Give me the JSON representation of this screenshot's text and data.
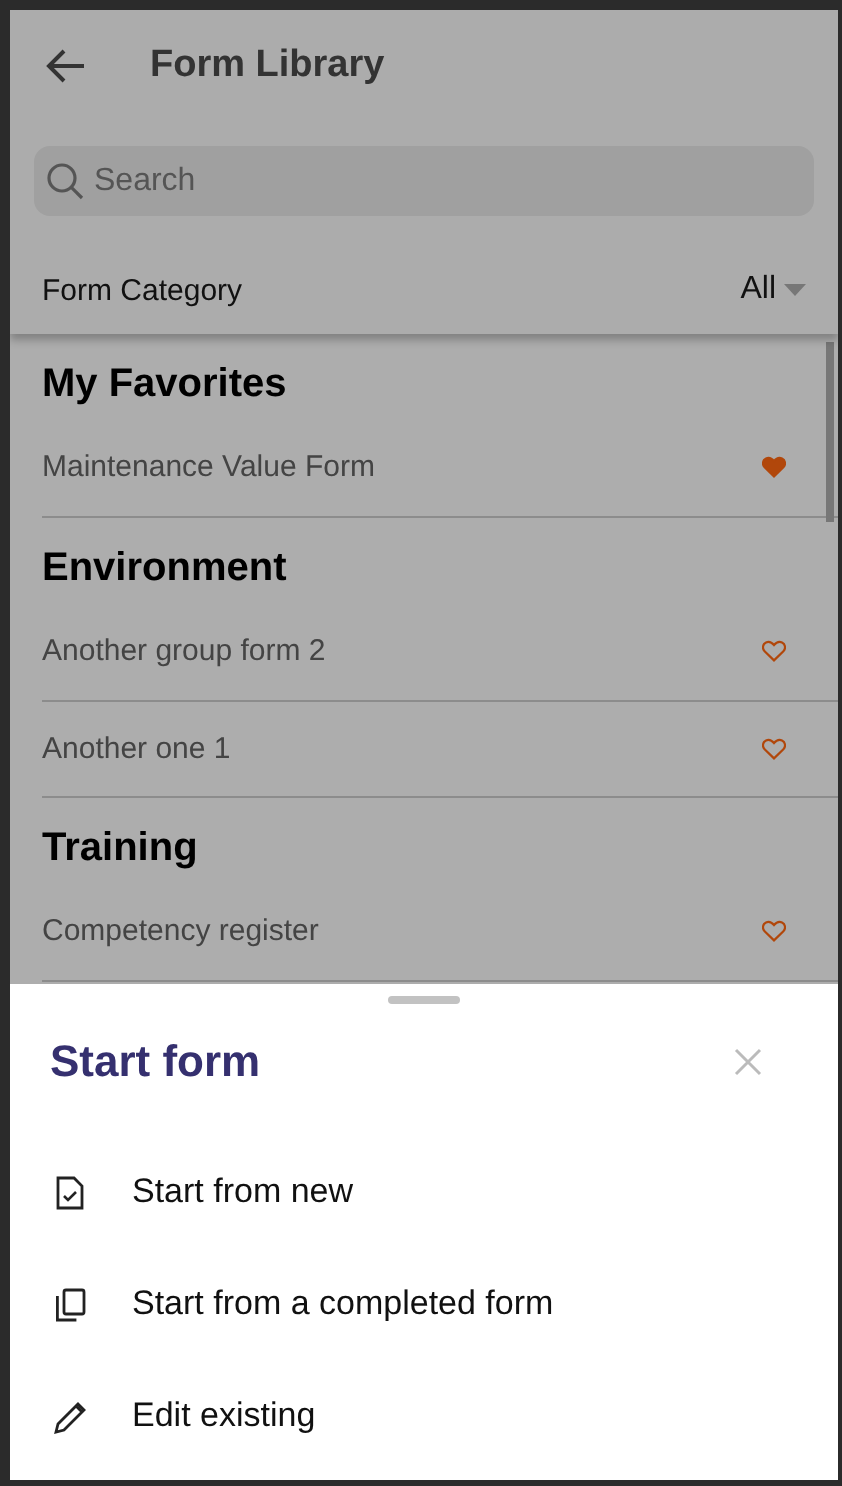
{
  "header": {
    "title": "Form Library"
  },
  "search": {
    "placeholder": "Search"
  },
  "filter": {
    "label": "Form Category",
    "value": "All"
  },
  "sections": [
    {
      "title": "My Favorites",
      "forms": [
        {
          "name": "Maintenance Value Form",
          "favorite": true
        }
      ]
    },
    {
      "title": "Environment",
      "forms": [
        {
          "name": "Another group form 2",
          "favorite": false
        },
        {
          "name": "Another one 1",
          "favorite": false
        }
      ]
    },
    {
      "title": "Training",
      "forms": [
        {
          "name": "Competency register",
          "favorite": false
        }
      ]
    }
  ],
  "sheet": {
    "title": "Start form",
    "options": [
      {
        "kind": "new",
        "label": "Start from new"
      },
      {
        "kind": "copy",
        "label": "Start from a completed form"
      },
      {
        "kind": "edit",
        "label": "Edit existing"
      }
    ]
  }
}
